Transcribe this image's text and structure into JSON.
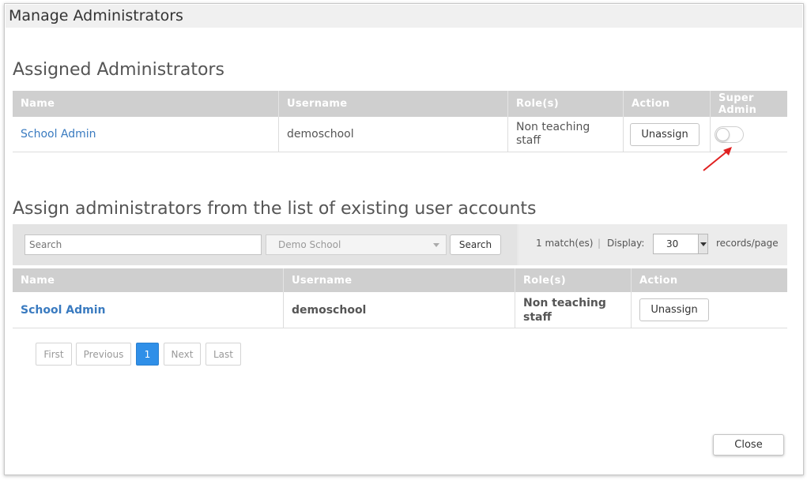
{
  "dialog": {
    "title": "Manage Administrators"
  },
  "assigned": {
    "heading": "Assigned Administrators",
    "columns": [
      "Name",
      "Username",
      "Role(s)",
      "Action",
      "Super Admin"
    ],
    "super_admin_line1": "Super",
    "super_admin_line2": "Admin",
    "rows": [
      {
        "name": "School Admin",
        "username": "demoschool",
        "role_line1": "Non teaching",
        "role_line2": "staff",
        "action_label": "Unassign",
        "super_admin_on": false
      }
    ]
  },
  "existing": {
    "heading": "Assign administrators from the list of existing user accounts",
    "search": {
      "placeholder": "Search",
      "school_value": "Demo School",
      "button_label": "Search"
    },
    "summary": {
      "matches": "1 match(es)",
      "separator": "|",
      "display_label": "Display:",
      "display_value": "30",
      "records_label": "records/page"
    },
    "columns": [
      "Name",
      "Username",
      "Role(s)",
      "Action"
    ],
    "rows": [
      {
        "name": "School Admin",
        "username": "demoschool",
        "role_line1": "Non teaching",
        "role_line2": "staff",
        "action_label": "Unassign"
      }
    ]
  },
  "pagination": {
    "first": "First",
    "previous": "Previous",
    "current": "1",
    "next": "Next",
    "last": "Last"
  },
  "footer": {
    "close_label": "Close"
  },
  "colors": {
    "link": "#3a7bc0",
    "header_bg": "#cfcfcf",
    "active_page": "#2f8fe8",
    "annotation_arrow": "#e02020"
  }
}
